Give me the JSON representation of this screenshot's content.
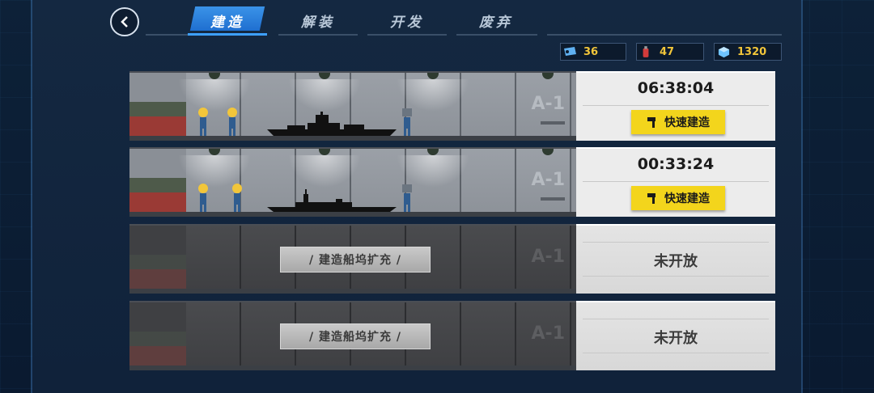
{
  "nav": {
    "back_icon": "back-arrow-icon",
    "tabs": [
      {
        "label": "建造",
        "active": true
      },
      {
        "label": "解装",
        "active": false
      },
      {
        "label": "开发",
        "active": false
      },
      {
        "label": "废弃",
        "active": false
      }
    ]
  },
  "resources": [
    {
      "icon": "ticket-icon",
      "value": "36"
    },
    {
      "icon": "extinguisher-icon",
      "value": "47"
    },
    {
      "icon": "cube-icon",
      "value": "1320"
    }
  ],
  "docks": [
    {
      "state": "building",
      "bay_label": "A-1",
      "timer": "06:38:04",
      "action_label": "快速建造"
    },
    {
      "state": "building",
      "bay_label": "A-1",
      "timer": "00:33:24",
      "action_label": "快速建造"
    },
    {
      "state": "locked",
      "bay_label": "A-1",
      "expand_label": "/ 建造船坞扩充 /",
      "status_label": "未开放"
    },
    {
      "state": "locked",
      "bay_label": "A-1",
      "expand_label": "/ 建造船坞扩充 /",
      "status_label": "未开放"
    }
  ],
  "colors": {
    "accent": "#2d7fe0",
    "resource_value": "#f2c63a",
    "fast_build_button": "#f3d51c"
  }
}
